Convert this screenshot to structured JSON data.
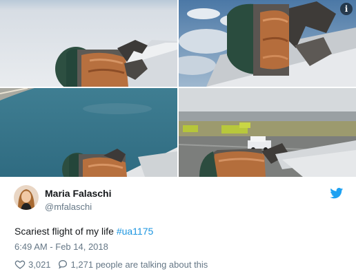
{
  "tweet": {
    "name": "Maria Falaschi",
    "handle": "@mfalaschi",
    "text_plain": "Scariest flight of my life ",
    "hashtag": "#ua1175",
    "timestamp": "6:49 AM - Feb 14, 2018",
    "likes": "3,021",
    "talking": "1,271 people are talking about this"
  },
  "media": {
    "info_icon": "i",
    "photos": [
      "engine-in-flight-over-clouds",
      "engine-closeup-over-clouds",
      "engine-over-ocean",
      "engine-on-runway-with-fire-trucks"
    ]
  },
  "icons": {
    "bird": "twitter-bird-icon",
    "heart": "heart-icon",
    "reply": "reply-bubble-icon",
    "info": "info-icon"
  },
  "colors": {
    "text": "#14171a",
    "muted": "#657786",
    "link": "#1b95e0",
    "bird": "#1da1f2"
  }
}
